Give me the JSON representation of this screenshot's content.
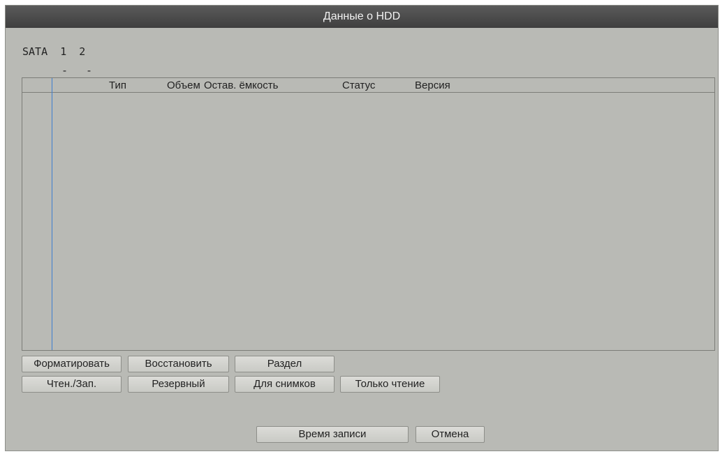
{
  "window": {
    "title": "Данные о HDD"
  },
  "sata": {
    "label": "SATA",
    "ports": [
      "1",
      "2"
    ],
    "port_status": [
      "-",
      "-"
    ]
  },
  "table": {
    "columns": [
      "Тип",
      "Объем",
      "Остав. ёмкость",
      "Статус",
      "Версия"
    ],
    "rows": []
  },
  "buttons": {
    "format": "Форматировать",
    "restore": "Восстановить",
    "partition": "Раздел",
    "read_write": "Чтен./Зап.",
    "redundant": "Резервный",
    "snapshot": "Для снимков",
    "read_only": "Только чтение",
    "record_time": "Время записи",
    "cancel": "Отмена"
  }
}
